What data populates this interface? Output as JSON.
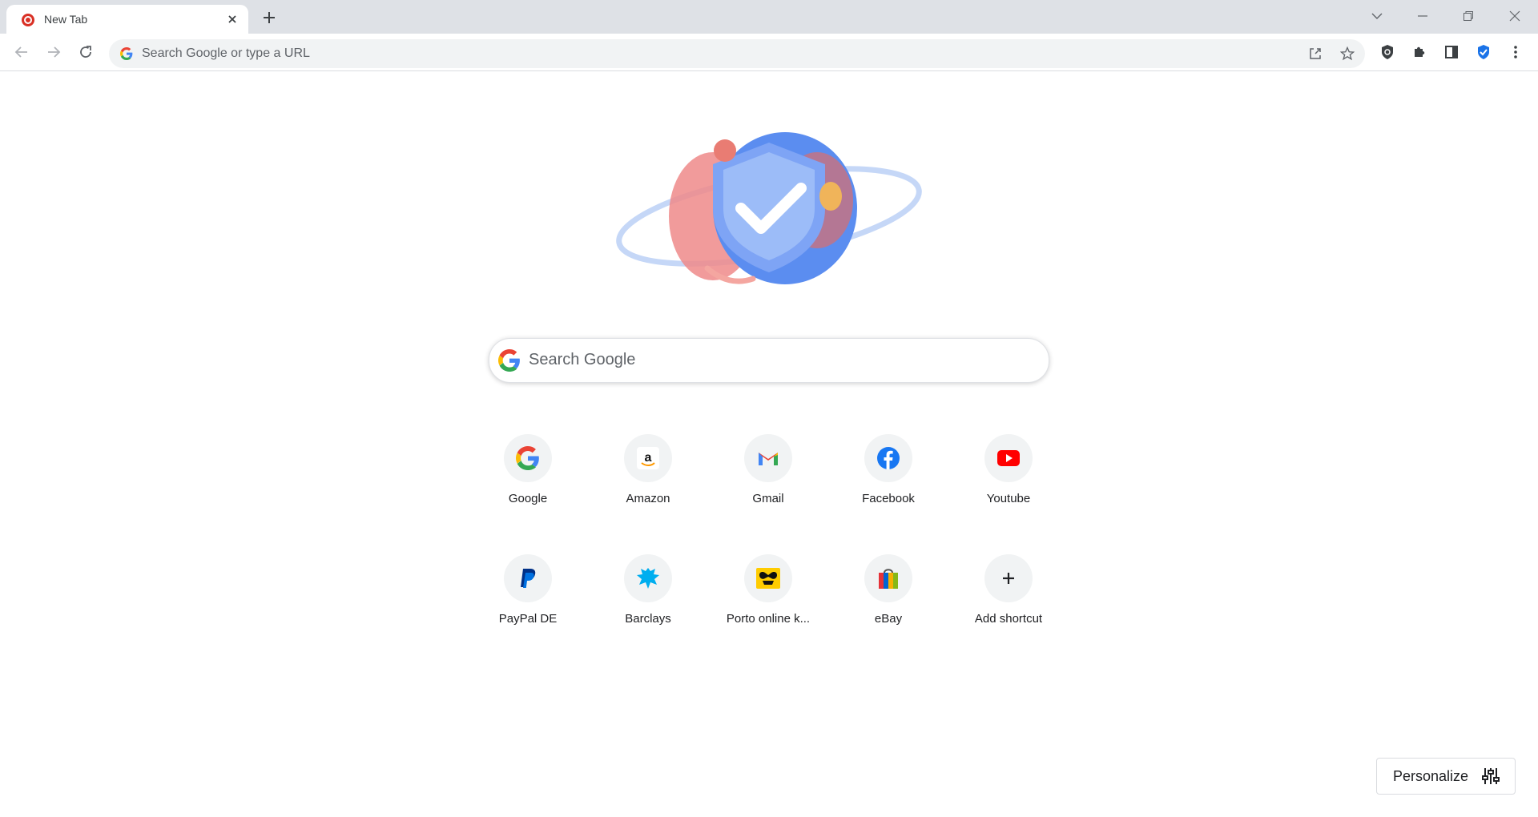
{
  "tab": {
    "title": "New Tab"
  },
  "window_controls": [
    "tab-search",
    "minimize",
    "restore",
    "close"
  ],
  "omnibox": {
    "placeholder": "Search Google or type a URL"
  },
  "search": {
    "placeholder": "Search Google"
  },
  "shortcuts": [
    {
      "label": "Google",
      "icon": "google-icon"
    },
    {
      "label": "Amazon",
      "icon": "amazon-icon"
    },
    {
      "label": "Gmail",
      "icon": "gmail-icon"
    },
    {
      "label": "Facebook",
      "icon": "facebook-icon"
    },
    {
      "label": "Youtube",
      "icon": "youtube-icon"
    },
    {
      "label": "PayPal DE",
      "icon": "paypal-icon"
    },
    {
      "label": "Barclays",
      "icon": "barclays-icon"
    },
    {
      "label": "Porto online k...",
      "icon": "deutsche-post-icon"
    },
    {
      "label": "eBay",
      "icon": "ebay-icon"
    },
    {
      "label": "Add shortcut",
      "icon": "plus-icon"
    }
  ],
  "personalize": {
    "label": "Personalize"
  },
  "colors": {
    "tabstrip": "#dee1e6",
    "omnibox": "#f1f3f4",
    "accent": "#1a73e8"
  }
}
